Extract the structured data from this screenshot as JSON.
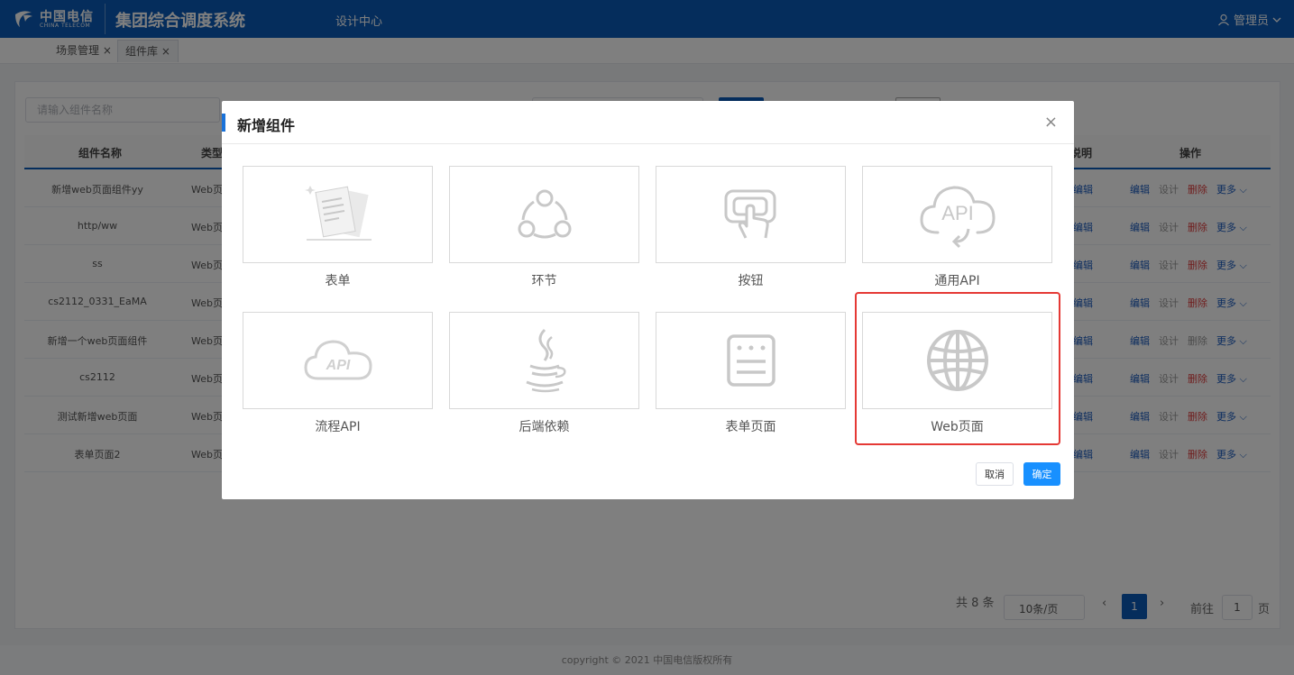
{
  "header": {
    "logo_cn": "中国电信",
    "logo_en": "CHINA TELECOM",
    "system_title": "集团综合调度系统",
    "nav_item": "设计中心",
    "user_name": "管理员"
  },
  "tabs": [
    {
      "label": "场景管理 ×"
    },
    {
      "label": "组件库 ×"
    }
  ],
  "search": {
    "placeholder": "请输入组件名称"
  },
  "table": {
    "headers": {
      "name": "组件名称",
      "type": "类型",
      "desc": "说明",
      "actions": "操作"
    },
    "rows": [
      {
        "name": "新增web页面组件yy",
        "type": "Web页",
        "edit": "编辑"
      },
      {
        "name": "http/ww",
        "type": "Web页",
        "edit": "编辑"
      },
      {
        "name": "ss",
        "type": "Web页",
        "edit": "编辑"
      },
      {
        "name": "cs2112_0331_EaMA",
        "type": "Web页",
        "edit": "编辑"
      },
      {
        "name": "新增一个web页面组件",
        "type": "Web页",
        "edit": "编辑"
      },
      {
        "name": "cs2112",
        "type": "Web页",
        "edit": "编辑"
      },
      {
        "name": "测试新增web页面",
        "type": "Web页",
        "edit": "编辑"
      },
      {
        "name": "表单页面2",
        "type": "Web页",
        "edit": "编辑"
      }
    ],
    "actions": {
      "edit": "编辑",
      "design": "设计",
      "delete": "删除",
      "more": "更多 ⌵"
    }
  },
  "pagination": {
    "total": "共 8 条",
    "page_size": "10条/页",
    "current_page": "1",
    "goto_label": "前往",
    "goto_value": "1",
    "goto_suffix": "页"
  },
  "footer": {
    "copyright": "copyright © 2021 中国电信版权所有"
  },
  "dialog": {
    "title": "新增组件",
    "close": "×",
    "components": [
      {
        "label": "表单",
        "icon": "form-icon"
      },
      {
        "label": "环节",
        "icon": "node-link-icon"
      },
      {
        "label": "按钮",
        "icon": "button-touch-icon"
      },
      {
        "label": "通用API",
        "icon": "api-cloud-icon"
      },
      {
        "label": "流程API",
        "icon": "process-api-icon"
      },
      {
        "label": "后端依赖",
        "icon": "java-icon"
      },
      {
        "label": "表单页面",
        "icon": "form-page-icon"
      },
      {
        "label": "Web页面",
        "icon": "globe-icon",
        "highlighted": true
      }
    ],
    "cancel": "取消",
    "confirm": "确定"
  },
  "colors": {
    "header_bg": "#0b5bb8",
    "primary": "#1890ff",
    "highlight_border": "#e53935",
    "icon_gray": "#cccccc"
  }
}
